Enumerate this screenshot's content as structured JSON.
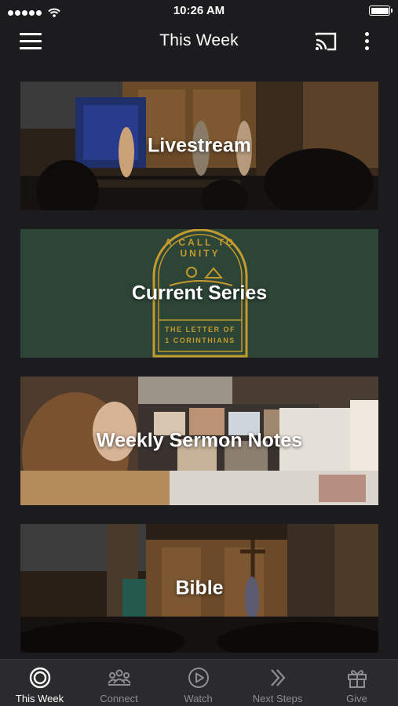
{
  "status_bar": {
    "time": "10:26 AM",
    "signal_icon": "signal-dots-icon",
    "wifi_icon": "wifi-icon",
    "battery_icon": "battery-icon"
  },
  "header": {
    "title": "This Week",
    "menu_icon": "hamburger-menu-icon",
    "cast_icon": "cast-icon",
    "more_icon": "more-vertical-icon"
  },
  "cards": [
    {
      "label": "Livestream"
    },
    {
      "label": "Current Series",
      "artwork_text": [
        "A CALL TO UNITY",
        "THE LETTER OF",
        "1 CORINTHIANS"
      ],
      "background_color": "#2c4536",
      "accent_color": "#c59a2e"
    },
    {
      "label": "Weekly Sermon Notes"
    },
    {
      "label": "Bible"
    }
  ],
  "tabs": [
    {
      "label": "This Week",
      "icon": "target-icon",
      "active": true
    },
    {
      "label": "Connect",
      "icon": "group-icon",
      "active": false
    },
    {
      "label": "Watch",
      "icon": "play-circle-icon",
      "active": false
    },
    {
      "label": "Next Steps",
      "icon": "double-chevron-right-icon",
      "active": false
    },
    {
      "label": "Give",
      "icon": "gift-icon",
      "active": false
    }
  ]
}
